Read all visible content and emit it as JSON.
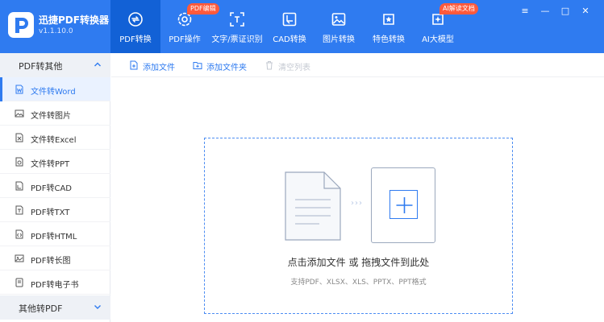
{
  "app": {
    "name": "迅捷PDF转换器",
    "version": "v1.1.10.0"
  },
  "nav": {
    "tabs": [
      {
        "label": "PDF转换",
        "icon": "convert-icon"
      },
      {
        "label": "PDF操作",
        "icon": "gear-pdf-icon",
        "badge": "PDF编辑"
      },
      {
        "label": "文字/票证识别",
        "icon": "ocr-scan-icon"
      },
      {
        "label": "CAD转换",
        "icon": "cad-icon"
      },
      {
        "label": "图片转换",
        "icon": "image-icon"
      },
      {
        "label": "特色转换",
        "icon": "star-convert-icon"
      },
      {
        "label": "AI大模型",
        "icon": "ai-model-icon",
        "badge": "AI解读文档"
      }
    ]
  },
  "window_controls": {
    "menu": "≡",
    "minimize": "—",
    "maximize": "□",
    "close": "✕"
  },
  "sidebar": {
    "group_pdf_to_other": "PDF转其他",
    "items": [
      {
        "label": "文件转Word",
        "icon": "word-file-icon"
      },
      {
        "label": "文件转图片",
        "icon": "picture-icon"
      },
      {
        "label": "文件转Excel",
        "icon": "excel-file-icon"
      },
      {
        "label": "文件转PPT",
        "icon": "ppt-file-icon"
      },
      {
        "label": "PDF转CAD",
        "icon": "cad-file-icon"
      },
      {
        "label": "PDF转TXT",
        "icon": "txt-file-icon"
      },
      {
        "label": "PDF转HTML",
        "icon": "html-file-icon"
      },
      {
        "label": "PDF转长图",
        "icon": "long-image-icon"
      },
      {
        "label": "PDF转电子书",
        "icon": "ebook-icon"
      }
    ],
    "group_other_to_pdf": "其他转PDF"
  },
  "toolbar": {
    "add_file": "添加文件",
    "add_folder": "添加文件夹",
    "clear_list": "清空列表"
  },
  "dropzone": {
    "title": "点击添加文件 或 拖拽文件到此处",
    "formats": "支持PDF、XLSX、XLS、PPTX、PPT格式",
    "arrows": "›››"
  },
  "colors": {
    "brand": "#2f7bf0",
    "brand_active": "#1261d6",
    "badge": "#ff5a3c"
  }
}
